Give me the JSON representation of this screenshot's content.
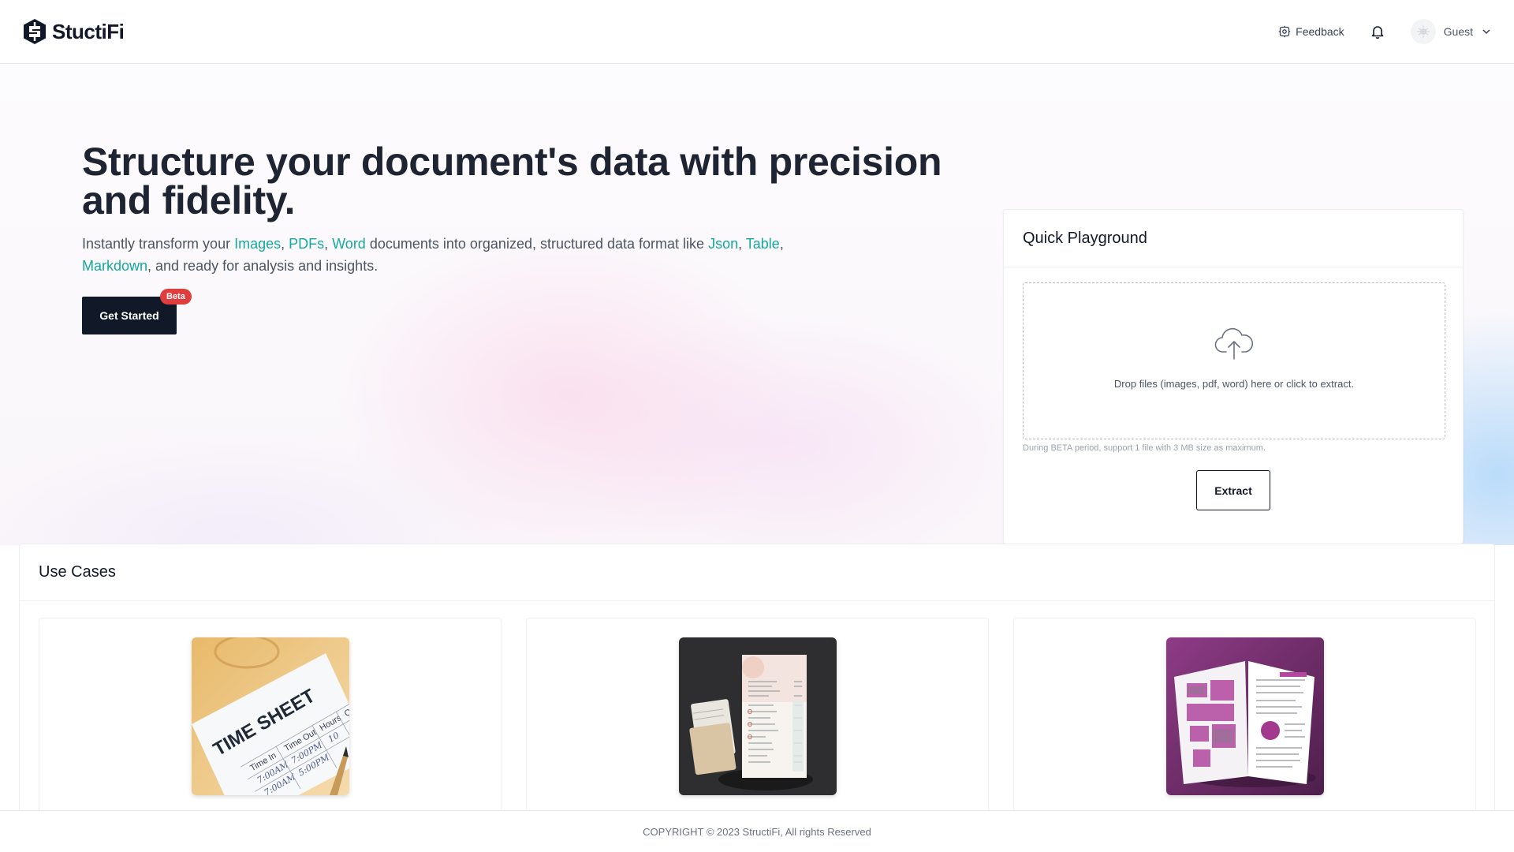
{
  "header": {
    "brand_name": "StuctiFi",
    "feedback_label": "Feedback",
    "user_label": "Guest"
  },
  "hero": {
    "title": "Structure your document's data with precision and fidelity.",
    "desc_prefix": "Instantly transform your ",
    "format_images": "Images",
    "sep1": ", ",
    "format_pdfs": "PDFs",
    "sep2": ", ",
    "format_word": "Word",
    "desc_middle": " documents into organized, structured data format like ",
    "format_json": "Json",
    "sep3": ", ",
    "format_table": "Table",
    "sep4": ", ",
    "format_markdown": "Markdown",
    "desc_suffix": ", and ready for analysis and insights.",
    "cta_label": "Get Started",
    "beta_badge": "Beta",
    "highlight_color": "#14a8a0"
  },
  "playground": {
    "title": "Quick Playground",
    "dropzone_text": "Drop files (images, pdf, word) here or click to extract.",
    "hint": "During BETA period, support 1 file with 3 MB size as maximum.",
    "extract_label": "Extract"
  },
  "use_cases": {
    "title": "Use Cases",
    "cards": [
      {
        "image": "time-sheet-image",
        "thumb_text": "TIME SHEET",
        "columns": [
          "Time In",
          "Time Out",
          "Hours",
          "O"
        ],
        "rows": [
          [
            "7:00AM",
            "7:00PM",
            "10"
          ],
          [
            "7:00AM",
            "5:00PM",
            ""
          ]
        ]
      },
      {
        "image": "receipt-image"
      },
      {
        "image": "brochure-image"
      }
    ]
  },
  "footer": {
    "copyright": "COPYRIGHT © 2023 StructiFi, All rights Reserved"
  },
  "colors": {
    "primary_dark": "#111827",
    "accent": "#14a8a0",
    "badge": "#e03e3e"
  }
}
